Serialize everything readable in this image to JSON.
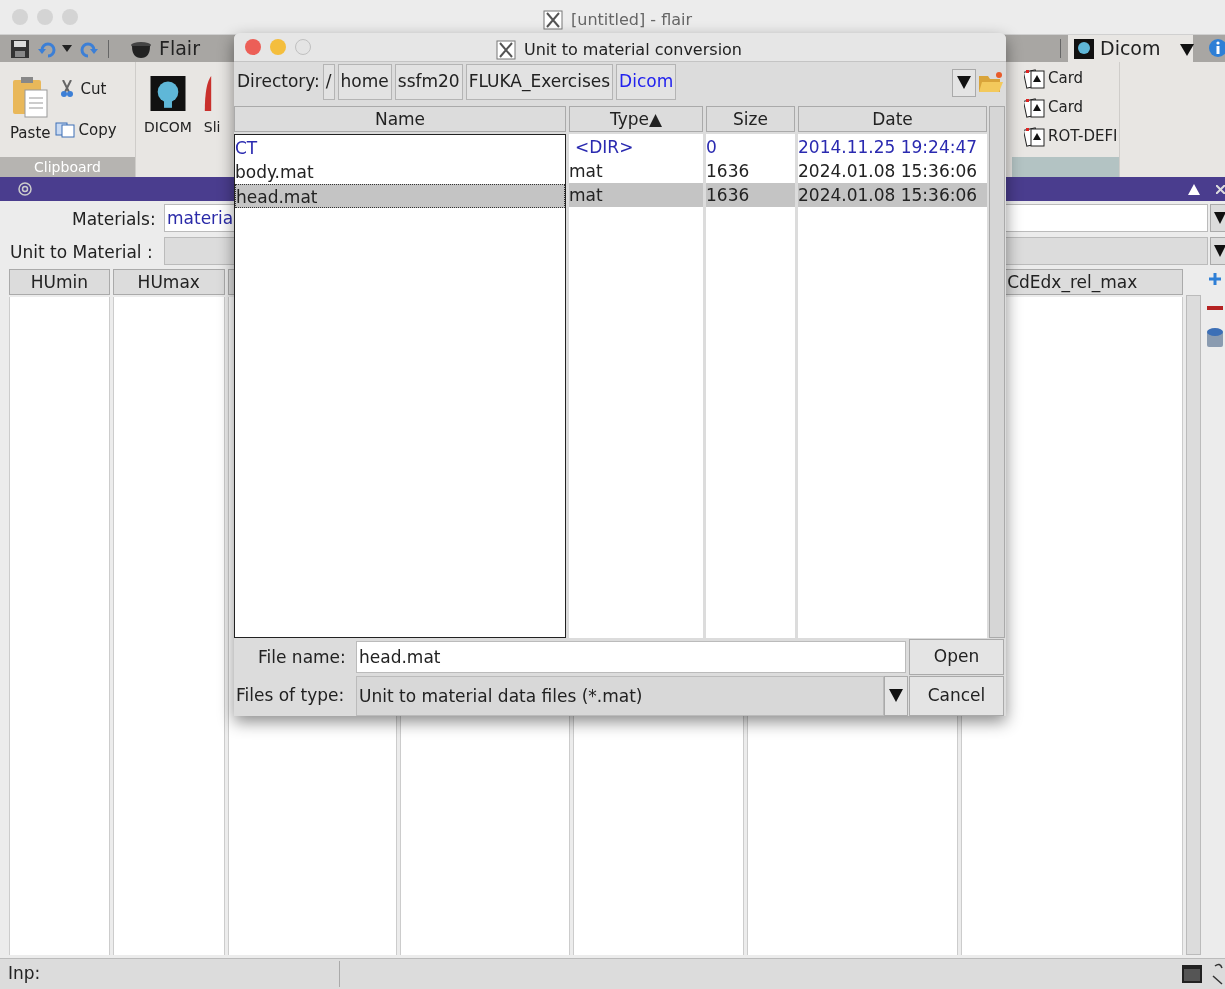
{
  "window": {
    "title": "[untitled] - flair"
  },
  "toolbar": {
    "app_tab": "Flair",
    "active_tab": "Dicom"
  },
  "ribbon": {
    "paste": "Paste",
    "cut": "Cut",
    "copy": "Copy",
    "group_label": "Clipboard",
    "dicom": "DICOM",
    "partial_item": "Sli",
    "cards": [
      "Card",
      "Card",
      "ROT-DEFI"
    ]
  },
  "panel": {
    "materials_label": "Materials:",
    "materials_value": "materia",
    "unit_label": "Unit to Material :",
    "columns": [
      {
        "label": "HUmin"
      },
      {
        "label": "HUmax"
      },
      {
        "label": "CdEdx_rel_max"
      }
    ]
  },
  "dialog": {
    "title": "Unit to material conversion",
    "directory_label": "Directory:",
    "path": [
      {
        "label": "/",
        "selected": false
      },
      {
        "label": "home",
        "selected": false
      },
      {
        "label": "ssfm20",
        "selected": false
      },
      {
        "label": "FLUKA_Exercises",
        "selected": false
      },
      {
        "label": "Dicom",
        "selected": true
      }
    ],
    "columns": [
      {
        "label": "Name"
      },
      {
        "label": "Type▲"
      },
      {
        "label": "Size"
      },
      {
        "label": "Date"
      }
    ],
    "rows": [
      {
        "kind": "dir",
        "name": "CT",
        "type": "<DIR>",
        "size": "0",
        "date": "2014.11.25 19:24:47",
        "selected": false
      },
      {
        "kind": "file",
        "name": "body.mat",
        "type": "mat",
        "size": "1636",
        "date": "2024.01.08 15:36:06",
        "selected": false
      },
      {
        "kind": "file",
        "name": "head.mat",
        "type": "mat",
        "size": "1636",
        "date": "2024.01.08 15:36:06",
        "selected": true
      }
    ],
    "file_name_label": "File name:",
    "file_name": "head.mat",
    "files_of_type_label": "Files of type:",
    "files_of_type": "Unit to material data files (*.mat)",
    "buttons": [
      "Open",
      "Cancel"
    ]
  },
  "status_bar": {
    "label": "Inp:"
  }
}
